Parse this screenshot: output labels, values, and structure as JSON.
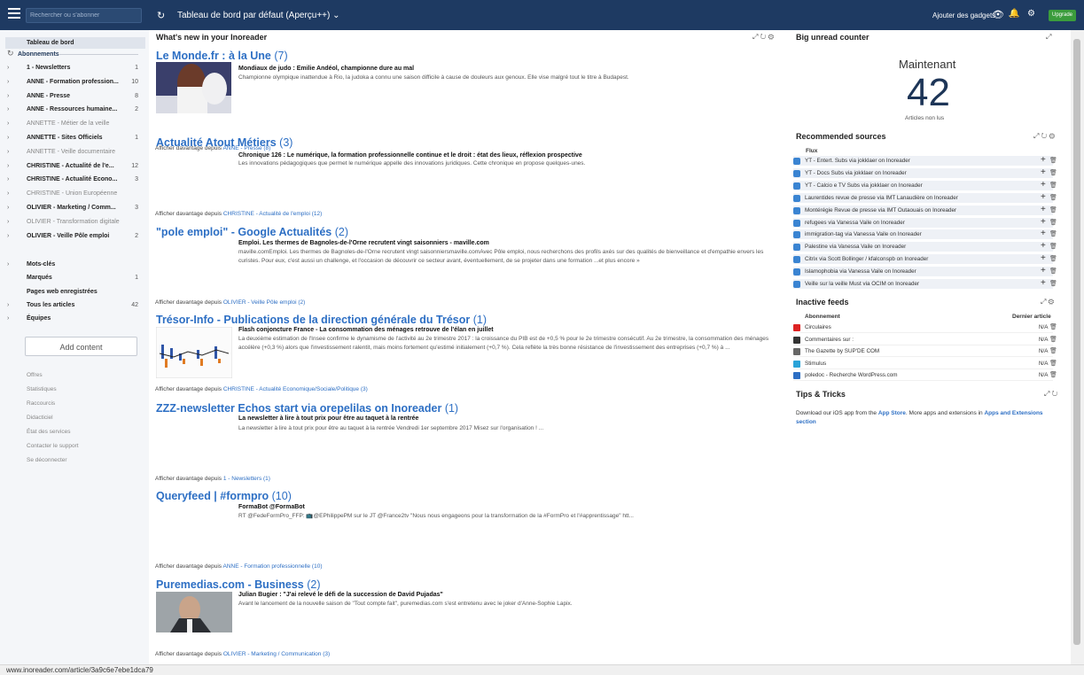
{
  "topbar": {
    "search_placeholder": "Rechercher ou s'abonner",
    "dashboard_title": "Tableau de bord par défaut (Aperçu++) ⌄",
    "add_gadgets": "Ajouter des gadgets",
    "upgrade": "Upgrade",
    "refresh_icon": "↻",
    "eye_icon": "👁 ⌄",
    "bell_icon": "🔔",
    "gear_icon": "⚙"
  },
  "sidebar": {
    "dashboard": "Tableau de bord",
    "subscriptions": "Abonnements",
    "folders": [
      {
        "label": "1 - Newsletters",
        "count": "1",
        "light": false
      },
      {
        "label": "ANNE - Formation profession...",
        "count": "10",
        "light": false
      },
      {
        "label": "ANNE - Presse",
        "count": "8",
        "light": false
      },
      {
        "label": "ANNE - Ressources humaine...",
        "count": "2",
        "light": false
      },
      {
        "label": "ANNETTE - Métier de la veille",
        "count": "",
        "light": true
      },
      {
        "label": "ANNETTE - Sites Officiels",
        "count": "1",
        "light": false
      },
      {
        "label": "ANNETTE - Veille documentaire",
        "count": "",
        "light": true
      },
      {
        "label": "CHRISTINE - Actualité de l'e...",
        "count": "12",
        "light": false
      },
      {
        "label": "CHRISTINE - Actualité Econo...",
        "count": "3",
        "light": false
      },
      {
        "label": "CHRISTINE - Union Européenne",
        "count": "",
        "light": true
      },
      {
        "label": "OLIVIER - Marketing / Comm...",
        "count": "3",
        "light": false
      },
      {
        "label": "OLIVIER - Transformation digitale",
        "count": "",
        "light": true
      },
      {
        "label": "OLIVIER - Veille Pôle emploi",
        "count": "2",
        "light": false
      }
    ],
    "keywords": "Mots-clés",
    "starred": "Marqués",
    "starred_count": "1",
    "saved_pages": "Pages web enregistrées",
    "all_articles": "Tous les articles",
    "all_count": "42",
    "teams": "Équipes",
    "add_content": "Add content",
    "footer_links": [
      "Offres",
      "Statistiques",
      "Raccourcis",
      "Didacticiel",
      "État des services",
      "Contacter le support",
      "Se déconnecter"
    ]
  },
  "whats_new": {
    "title": "What's new in your Inoreader",
    "controls": "⤢ ↻ ⚙",
    "feeds": [
      {
        "name": "Le Monde.fr : à la Une",
        "count": "(7)",
        "article_title": "Mondiaux de judo : Emilie Andéol, championne dure au mal",
        "summary": "Championne olympique inattendue à Rio, la judoka a connu une saison difficile à cause de douleurs aux genoux. Elle vise malgré tout le titre à Budapest.",
        "more_prefix": "Afficher davantage depuis",
        "more_link": "ANNE - Presse (8)"
      },
      {
        "name": "Actualité Atout Métiers",
        "count": "(3)",
        "article_title": "Chronique 126 : Le numérique, la formation professionnelle continue et le droit : état des lieux, réflexion prospective",
        "summary": "Les innovations pédagogiques que permet le numérique appelle des innovations juridiques. Cette chronique en propose quelques-unes.",
        "more_prefix": "Afficher davantage depuis",
        "more_link": "CHRISTINE - Actualité de l'emploi (12)"
      },
      {
        "name": "\"pole emploi\" - Google Actualités",
        "count": "(2)",
        "article_title": "Emploi. Les thermes de Bagnoles-de-l'Orne recrutent vingt saisonniers - maville.com",
        "summary": "maville.comEmploi. Les thermes de Bagnoles-de-l'Orne recrutent vingt saisonniersmaville.comAvec Pôle emploi, nous recherchons des profils axés sur des qualités de bienveillance et d'empathie envers les curistes. Pour eux, c'est aussi un challenge, et l'occasion de découvrir ce secteur avant, éventuellement, de se projeter dans une formation ...et plus encore »",
        "more_prefix": "Afficher davantage depuis",
        "more_link": "OLIVIER - Veille Pôle emploi (2)"
      },
      {
        "name": "Trésor-Info - Publications de la direction générale du Trésor",
        "count": "(1)",
        "article_title": "Flash conjoncture France - La consommation des ménages retrouve de l'élan en juillet",
        "summary": "La deuxième estimation de l'Insee confirme le dynamisme de l'activité au 2e trimestre 2017 : la croissance du PIB est de +0,5 % pour le 2e trimestre consécutif. Au 2e trimestre, la consommation des ménages accélère (+0,3 %) alors que l'investissement ralentit, mais moins fortement qu'estimé initialement (+0,7 %). Cela reflète la très bonne résistance de l'investissement des entreprises (+0,7 %) à ...",
        "more_prefix": "Afficher davantage depuis",
        "more_link": "CHRISTINE - Actualité Economique/Sociale/Politique (3)"
      },
      {
        "name": "ZZZ-newsletter Echos start via orepelilas on Inoreader",
        "count": "(1)",
        "article_title": "La newsletter à lire à tout prix pour être au taquet à la rentrée",
        "summary": "La newsletter à lire à tout prix pour être au taquet à la rentrée     Vendredi 1er septembre 2017 Misez sur l'organisation ! ...",
        "more_prefix": "Afficher davantage depuis",
        "more_link": "1 - Newsletters (1)"
      },
      {
        "name": "Queryfeed | #formpro",
        "count": "(10)",
        "article_title": "FormaBot @FormaBot",
        "summary": "RT @FedeFormPro_FFP: 📺@EPhilippePM sur le JT @France2tv \"Nous nous engageons pour la transformation de la #FormPro et l'#apprentissage\" htt...",
        "more_prefix": "Afficher davantage depuis",
        "more_link": "ANNE - Formation professionnelle (10)"
      },
      {
        "name": "Puremedias.com - Business",
        "count": "(2)",
        "article_title": "Julian Bugier : \"J'ai relevé le défi de la succession de David Pujadas\"",
        "summary": "Avant le lancement de la nouvelle saison de \"Tout compte fait\", puremedias.com s'est entretenu avec le joker d'Anne-Sophie Lapix.",
        "more_prefix": "Afficher davantage depuis",
        "more_link": "OLIVIER - Marketing / Communication (3)"
      }
    ]
  },
  "unread": {
    "title": "Big unread counter",
    "label": "Maintenant",
    "number": "42",
    "sub": "Articles non lus"
  },
  "recommended": {
    "title": "Recommended sources",
    "header": "Flux",
    "items": [
      "YT - Entert. Subs via jokklaer on Inoreader",
      "YT - Docs Subs via jokklaer on Inoreader",
      "YT - Calcio e TV Subs via jokklaer on Inoreader",
      "Laurentides revue de presse via IMT Lanaudière on Inoreader",
      "Montérégie Revue de presse via IMT Outaouais on Inoreader",
      "refugees via Vanessa Vaile on Inoreader",
      "immigration-tag via Vanessa Vaile on Inoreader",
      "Palestine via Vanessa Vaile on Inoreader",
      "Citrix via Scott Bollinger / kfalconspb on Inoreader",
      "Islamophobia via Vanessa Vaile on Inoreader",
      "Veille sur la veille Must via OCIM on Inoreader"
    ]
  },
  "inactive": {
    "title": "Inactive feeds",
    "col1": "Abonnement",
    "col2": "Dernier article",
    "items": [
      {
        "name": "Circulaires",
        "value": "N/A",
        "icon": "flag-fr-icon",
        "color": "#d22"
      },
      {
        "name": "Commentaires sur :",
        "value": "N/A",
        "icon": "rss-icon",
        "color": "#333"
      },
      {
        "name": "The Gazette by SUP'DE COM",
        "value": "N/A",
        "icon": "gazette-icon",
        "color": "#666"
      },
      {
        "name": "Stimulus",
        "value": "N/A",
        "icon": "stimulus-icon",
        "color": "#2aa3d8"
      },
      {
        "name": "poledoc - Recherche WordPress.com",
        "value": "N/A",
        "icon": "wordpress-icon",
        "color": "#2d6fc4"
      }
    ]
  },
  "tips": {
    "title": "Tips & Tricks",
    "text_before": "Download our iOS app from the ",
    "link1": "App Store",
    "text_mid": ". More apps and extensions in ",
    "link2": "Apps and Extensions section"
  },
  "status": {
    "url": "www.inoreader.com/article/3a9c6e7ebe1dca79"
  }
}
